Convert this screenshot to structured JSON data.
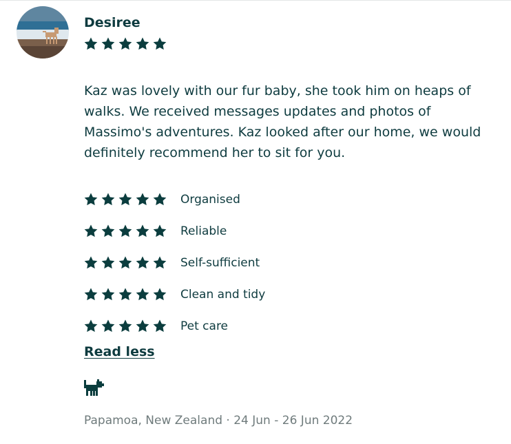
{
  "review": {
    "reviewer_name": "Desiree",
    "overall_rating": 5,
    "text": "Kaz was lovely with our fur baby, she took him on heaps of walks. We received messages updates and photos of Massimo's adventures. Kaz looked after our home, we would definitely recommend her to sit for you.",
    "categories": [
      {
        "label": "Organised",
        "rating": 5
      },
      {
        "label": "Reliable",
        "rating": 5
      },
      {
        "label": "Self-sufficient",
        "rating": 5
      },
      {
        "label": "Clean and tidy",
        "rating": 5
      },
      {
        "label": "Pet care",
        "rating": 5
      }
    ],
    "read_less_label": "Read less",
    "pet_icon": "dog-icon",
    "meta": "Papamoa, New Zealand · 24 Jun - 26 Jun 2022"
  },
  "colors": {
    "primary": "#0e3b3f",
    "star": "#0b3d3e",
    "muted": "#6f7b7c"
  }
}
